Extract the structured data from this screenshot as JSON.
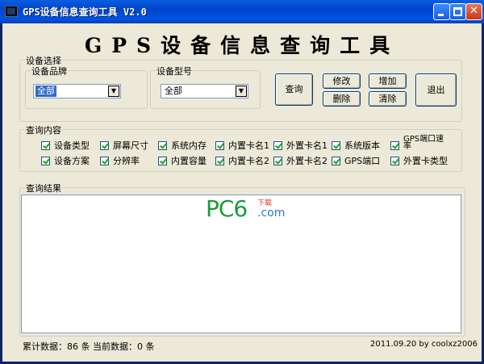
{
  "window": {
    "title": "GPS设备信息查询工具 V2.0"
  },
  "app_title": "GPS设备信息查询工具",
  "device_select": {
    "legend": "设备选择",
    "brand_legend": "设备品牌",
    "brand_value": "全部",
    "model_legend": "设备型号",
    "model_value": "全部"
  },
  "buttons": {
    "query": "查询",
    "modify": "修改",
    "add": "增加",
    "delete": "删除",
    "clear": "清除",
    "exit": "退出"
  },
  "query_content": {
    "legend": "查询内容",
    "row1": [
      "设备类型",
      "屏幕尺寸",
      "系统内存",
      "内置卡名1",
      "外置卡名1",
      "系统版本",
      "GPS端口速率"
    ],
    "row2": [
      "设备方案",
      "分辨率",
      "内置容量",
      "内置卡名2",
      "外置卡名2",
      "GPS端口",
      "外置卡类型"
    ]
  },
  "results": {
    "legend": "查询结果"
  },
  "watermark": {
    "pc": "PC6",
    "small": "下载",
    "com": ".com"
  },
  "status": {
    "left": "累计数据：86 条    当前数据：0 条",
    "right": "2011.09.20 by coolxz2006"
  },
  "colors": {
    "titlebar": "#0054e3",
    "client": "#ece9d8",
    "selection": "#316ac5",
    "check": "#21a121"
  }
}
